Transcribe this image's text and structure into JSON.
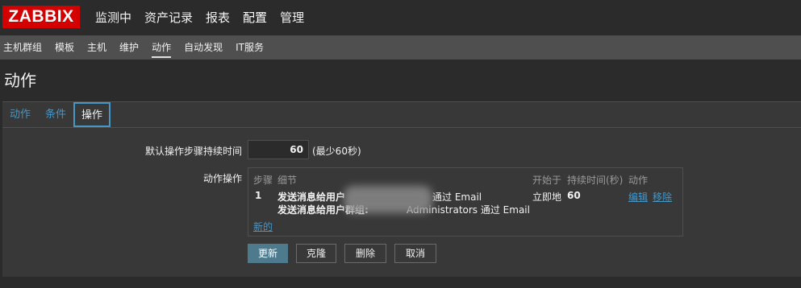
{
  "app": {
    "logo": "ZABBIX"
  },
  "top_menu": [
    {
      "label": "监测中"
    },
    {
      "label": "资产记录"
    },
    {
      "label": "报表"
    },
    {
      "label": "配置",
      "active": true
    },
    {
      "label": "管理"
    }
  ],
  "sub_menu": [
    {
      "label": "主机群组"
    },
    {
      "label": "模板"
    },
    {
      "label": "主机"
    },
    {
      "label": "维护"
    },
    {
      "label": "动作",
      "active": true
    },
    {
      "label": "自动发现"
    },
    {
      "label": "IT服务"
    }
  ],
  "page": {
    "title": "动作"
  },
  "tabs": [
    {
      "label": "动作"
    },
    {
      "label": "条件"
    },
    {
      "label": "操作",
      "active": true
    }
  ],
  "form": {
    "step_duration_label": "默认操作步骤持续时间",
    "step_duration_value": "60",
    "step_duration_hint": "(最少60秒)",
    "operations_label": "动作操作"
  },
  "operations_table": {
    "headers": {
      "step": "步骤",
      "details": "细节",
      "start_in": "开始于",
      "duration": "持续时间(秒)",
      "action": "动作"
    },
    "rows": [
      {
        "step": "1",
        "details_line1_prefix": "发送消息给用户",
        "details_line1_suffix": "通过 Email",
        "details_line2_prefix": "发送消息给用户群组:",
        "details_line2_suffix": "Administrators 通过 Email",
        "start_in": "立即地",
        "duration": "60",
        "edit_label": "编辑",
        "remove_label": "移除"
      }
    ],
    "new_link": "新的"
  },
  "buttons": {
    "update": "更新",
    "clone": "克隆",
    "delete": "删除",
    "cancel": "取消"
  },
  "colors": {
    "brand_red": "#d40000",
    "link_blue": "#4796c4",
    "primary_button": "#4d7a8c",
    "background": "#2b2b2b",
    "panel": "#383838"
  }
}
